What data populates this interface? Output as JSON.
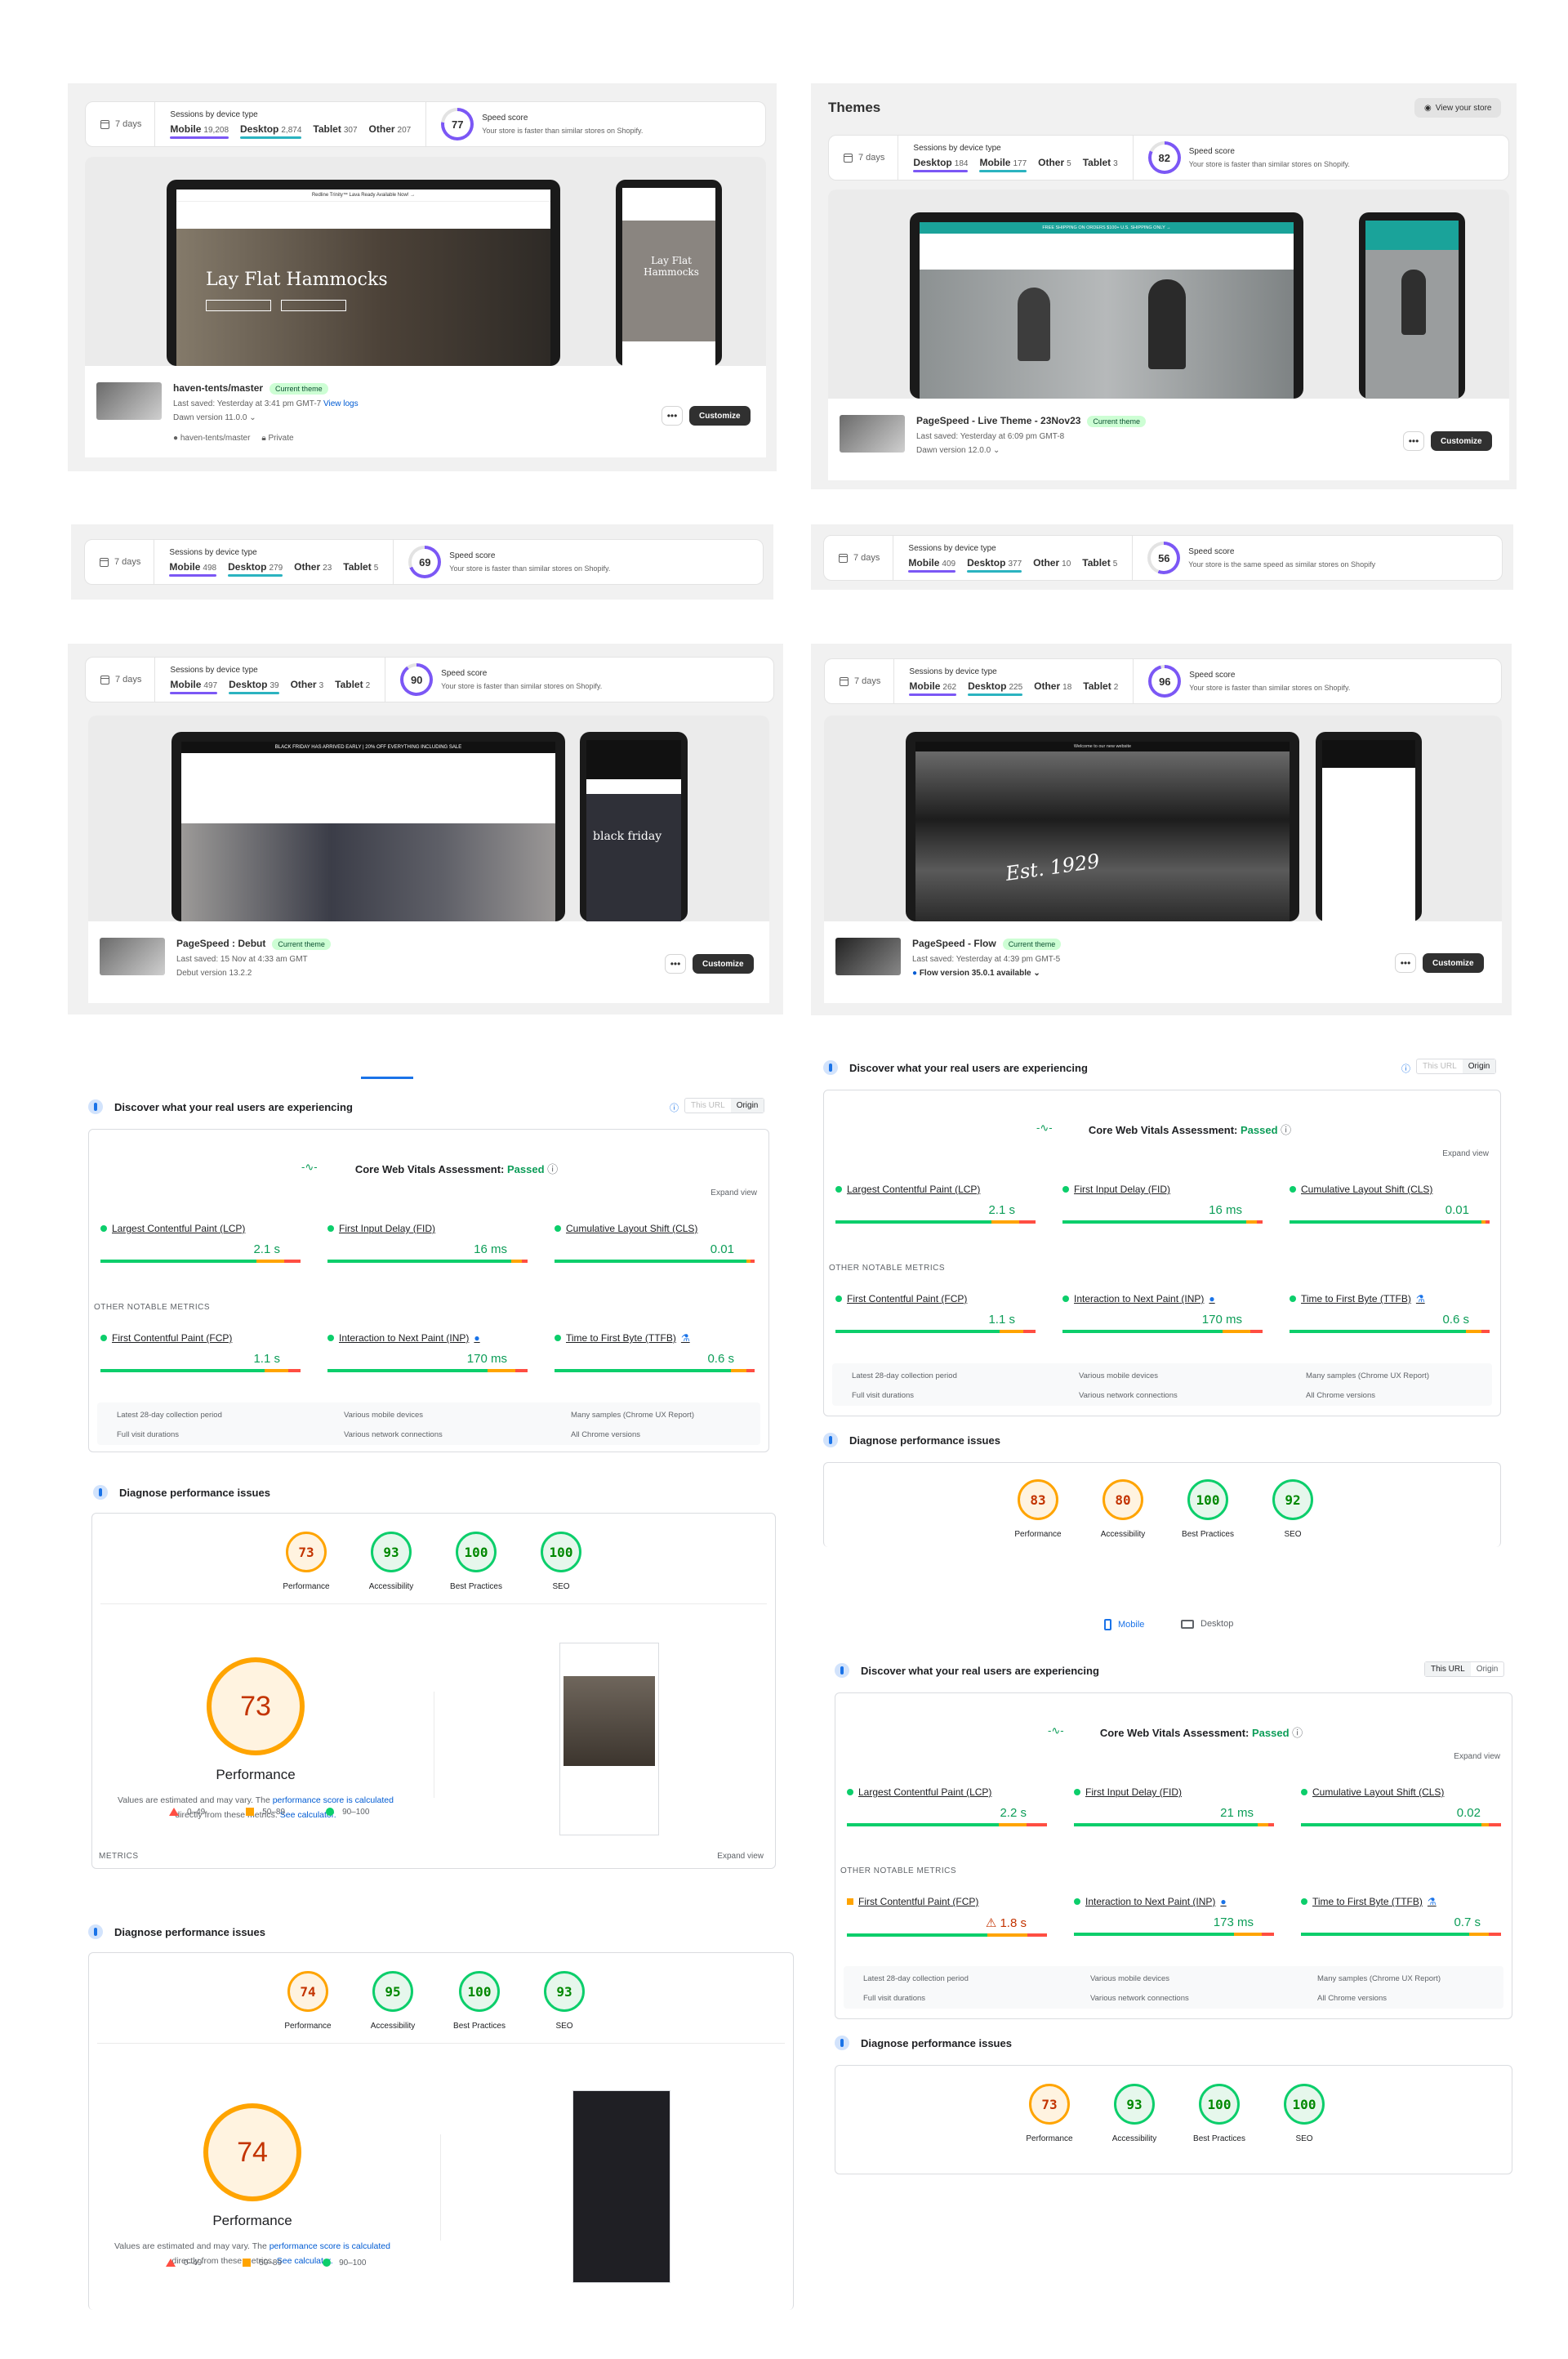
{
  "colors": {
    "accent": "#7b57f5",
    "secondary": "#2bb3c0",
    "pass": "#0c9d58",
    "orange": "#ffa400",
    "red": "#ff4e42"
  },
  "labels": {
    "days": "7 days",
    "sessions": "Sessions by device type",
    "speed": "Speed score",
    "customize": "Customize",
    "current": "Current theme",
    "dots": "•••"
  },
  "card1": {
    "devices": [
      {
        "name": "Mobile",
        "n": "19,208"
      },
      {
        "name": "Desktop",
        "n": "2,874"
      },
      {
        "name": "Tablet",
        "n": "307"
      },
      {
        "name": "Other",
        "n": "207"
      }
    ],
    "score": "77",
    "score_pct": 77,
    "msg": "Your store is faster than similar stores on Shopify.",
    "theme": "haven-tents/master",
    "saved": "Last saved: Yesterday at 3:41 pm GMT-7",
    "viewlogs": "View logs",
    "version": "Dawn version 11.0.0",
    "repo": "haven-tents/master",
    "private": "Private",
    "hero": "Lay Flat Hammocks",
    "phone_hero": "Lay Flat Hammocks",
    "ann": "Redline Trinity™ Lava Ready Available Now! →"
  },
  "themes": {
    "title": "Themes",
    "view": "View your store"
  },
  "card2": {
    "devices": [
      {
        "name": "Desktop",
        "n": "184"
      },
      {
        "name": "Mobile",
        "n": "177"
      },
      {
        "name": "Other",
        "n": "5"
      },
      {
        "name": "Tablet",
        "n": "3"
      }
    ],
    "score": "82",
    "score_pct": 82,
    "msg": "Your store is faster than similar stores on Shopify.",
    "theme": "PageSpeed - Live Theme - 23Nov23",
    "saved": "Last saved: Yesterday at 6:09 pm GMT-8",
    "version": "Dawn version 12.0.0",
    "ann": "FREE SHIPPING ON ORDERS $100+ U.S. SHIPPING ONLY →"
  },
  "card3": {
    "devices": [
      {
        "name": "Mobile",
        "n": "498"
      },
      {
        "name": "Desktop",
        "n": "279"
      },
      {
        "name": "Other",
        "n": "23"
      },
      {
        "name": "Tablet",
        "n": "5"
      }
    ],
    "score": "69",
    "score_pct": 69,
    "msg": "Your store is faster than similar stores on Shopify."
  },
  "card4": {
    "devices": [
      {
        "name": "Mobile",
        "n": "409"
      },
      {
        "name": "Desktop",
        "n": "377"
      },
      {
        "name": "Other",
        "n": "10"
      },
      {
        "name": "Tablet",
        "n": "5"
      }
    ],
    "score": "56",
    "score_pct": 56,
    "msg": "Your store is the same speed as similar stores on Shopify"
  },
  "card5": {
    "devices": [
      {
        "name": "Mobile",
        "n": "497"
      },
      {
        "name": "Desktop",
        "n": "39"
      },
      {
        "name": "Other",
        "n": "3"
      },
      {
        "name": "Tablet",
        "n": "2"
      }
    ],
    "score": "90",
    "score_pct": 90,
    "msg": "Your store is faster than similar stores on Shopify.",
    "theme": "PageSpeed : Debut",
    "saved": "Last saved: 15 Nov at 4:33 am GMT",
    "version": "Debut version 13.2.2",
    "ann": "BLACK FRIDAY HAS ARRIVED EARLY | 20% OFF EVERYTHING INCLUDING SALE",
    "phone_hero": "black friday"
  },
  "card6": {
    "devices": [
      {
        "name": "Mobile",
        "n": "262"
      },
      {
        "name": "Desktop",
        "n": "225"
      },
      {
        "name": "Other",
        "n": "18"
      },
      {
        "name": "Tablet",
        "n": "2"
      }
    ],
    "score": "96",
    "score_pct": 96,
    "msg": "Your store is faster than similar stores on Shopify.",
    "theme": "PageSpeed - Flow",
    "saved": "Last saved: Yesterday at 4:39 pm GMT-5",
    "version": "Flow version 35.0.1 available",
    "ann": "Welcome to our new website",
    "hero": "Est. 1929"
  },
  "ps": {
    "discover": "Discover what your real users are experiencing",
    "this_url": "This URL",
    "origin": "Origin",
    "cwv": "Core Web Vitals Assessment: ",
    "passed": "Passed",
    "expand": "Expand view",
    "other": "OTHER NOTABLE METRICS",
    "lcp": "Largest Contentful Paint (LCP)",
    "fid": "First Input Delay (FID)",
    "cls": "Cumulative Layout Shift (CLS)",
    "fcp": "First Contentful Paint (FCP)",
    "inp": "Interaction to Next Paint (INP)",
    "ttfb": "Time to First Byte (TTFB)",
    "f1": "Latest 28-day collection period",
    "f2": "Various mobile devices",
    "f3": "Many samples (Chrome UX Report)",
    "f4": "Full visit durations",
    "f5": "Various network connections",
    "f6": "All Chrome versions",
    "diagnose": "Diagnose performance issues",
    "perf": "Performance",
    "acc": "Accessibility",
    "bp": "Best Practices",
    "seo": "SEO",
    "metrics": "METRICS",
    "estimated": "Values are estimated and may vary. The ",
    "calc_link": "performance score is calculated",
    "directly": " directly from these metrics. ",
    "see": "See calculator.",
    "l1": "0–49",
    "l2": "50–89",
    "l3": "90–100",
    "mobile": "Mobile",
    "desktop": "Desktop"
  },
  "psA": {
    "lcp": "2.1 s",
    "fid": "16 ms",
    "cls": "0.01",
    "fcp": "1.1 s",
    "inp": "170 ms",
    "ttfb": "0.6 s",
    "perf": "73",
    "acc": "93",
    "bp": "100",
    "seo": "100"
  },
  "psB": {
    "lcp": "2.1 s",
    "fid": "16 ms",
    "cls": "0.01",
    "fcp": "1.1 s",
    "inp": "170 ms",
    "ttfb": "0.6 s",
    "perf": "83",
    "acc": "80",
    "bp": "100",
    "seo": "92"
  },
  "psC": {
    "perf": "74",
    "acc": "95",
    "bp": "100",
    "seo": "93"
  },
  "psD": {
    "lcp": "2.2 s",
    "fid": "21 ms",
    "cls": "0.02",
    "fcp": "1.8 s",
    "inp": "173 ms",
    "ttfb": "0.7 s",
    "perf": "73",
    "acc": "93",
    "bp": "100",
    "seo": "100"
  }
}
